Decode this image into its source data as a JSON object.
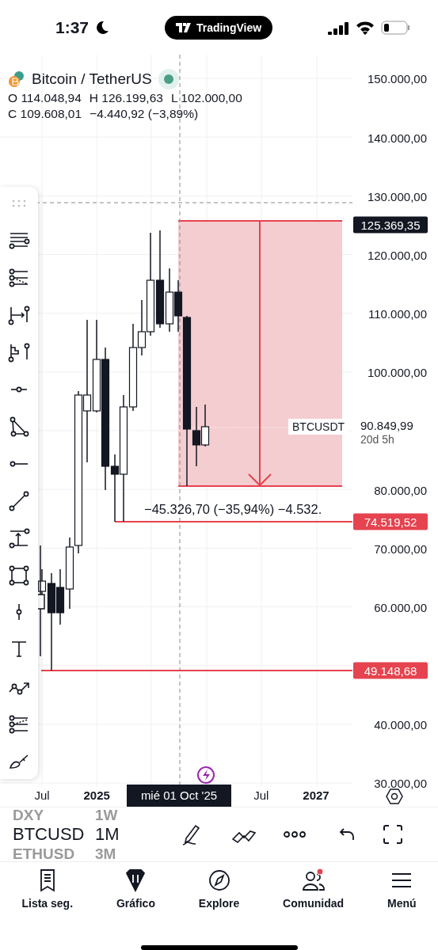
{
  "status_bar": {
    "time": "1:37",
    "app_pill": "TradingView"
  },
  "legend": {
    "symbol": "Bitcoin / TetherUS",
    "market_open": true,
    "ohlc": [
      {
        "label": "O",
        "value": "114.048,94"
      },
      {
        "label": "H",
        "value": "126.199,63"
      },
      {
        "label": "L",
        "value": "102.000,00"
      },
      {
        "label": "C",
        "value": "109.608,01"
      }
    ],
    "change": "−4.440,92 (−3,89%)"
  },
  "price_axis": {
    "ticks": [
      "150.000,00",
      "140.000,00",
      "130.000,00",
      "120.000,00",
      "110.000,00",
      "100.000,00",
      "80.000,00",
      "70.000,00",
      "60.000,00",
      "40.000,00",
      "30.000,00"
    ]
  },
  "price_badges": [
    {
      "label": "125.369,35",
      "kind": "crosshair"
    },
    {
      "label": "74.519,52",
      "kind": "level"
    },
    {
      "label": "49.148,68",
      "kind": "level"
    }
  ],
  "last_price": {
    "symbol": "BTCUSDT",
    "price": "90.849,99",
    "countdown": "20d 5h"
  },
  "position_label": "−45.326,70 (−35,94%) −4.532.",
  "time_axis": {
    "labels": [
      {
        "label": "Jul",
        "kind": "month"
      },
      {
        "label": "2025",
        "kind": "year"
      },
      {
        "label": "Jul",
        "kind": "month"
      },
      {
        "label": "2027",
        "kind": "year"
      }
    ],
    "crosshair_date": "mié 01 Oct '25"
  },
  "symbols": [
    {
      "label": "DXY",
      "selected": false
    },
    {
      "label": "BTCUSD",
      "selected": true
    },
    {
      "label": "ETHUSD",
      "selected": false
    }
  ],
  "intervals": [
    {
      "label": "1W",
      "selected": false
    },
    {
      "label": "1M",
      "selected": true
    },
    {
      "label": "3M",
      "selected": false
    }
  ],
  "tabs": [
    {
      "label": "Lista seg.",
      "selected": false,
      "notification": false
    },
    {
      "label": "Gráfico",
      "selected": true,
      "notification": false
    },
    {
      "label": "Explore",
      "selected": false,
      "notification": false
    },
    {
      "label": "Comunidad",
      "selected": false,
      "notification": true
    },
    {
      "label": "Menú",
      "selected": false,
      "notification": false
    }
  ]
}
